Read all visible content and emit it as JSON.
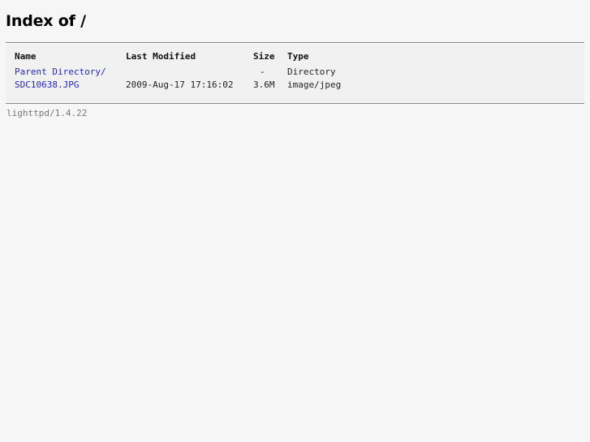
{
  "page": {
    "title": "Index of /",
    "footer": "lighttpd/1.4.22"
  },
  "table": {
    "headers": {
      "name": "Name",
      "last_modified": "Last Modified",
      "size": "Size",
      "type": "Type"
    },
    "rows": [
      {
        "name": "Parent Directory/",
        "last_modified": "",
        "size": "-",
        "type": "Directory"
      },
      {
        "name": "SDC10638.JPG",
        "last_modified": "2009-Aug-17 17:16:02",
        "size": "3.6M",
        "type": "image/jpeg"
      }
    ]
  },
  "colors": {
    "link": "#2424c8",
    "background": "#f6f6f6",
    "rule": "#8a8a8a"
  }
}
